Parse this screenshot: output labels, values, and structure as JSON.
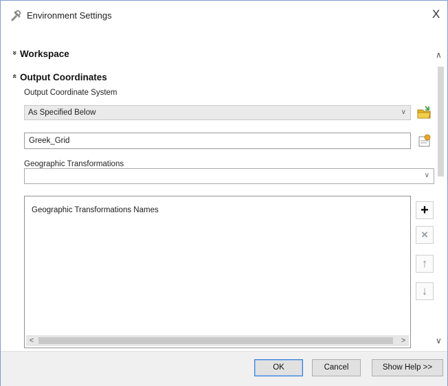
{
  "window": {
    "title": "Environment Settings",
    "close_glyph": "X"
  },
  "sections": {
    "workspace": {
      "label": "Workspace",
      "chevron": "»",
      "state": "collapsed"
    },
    "output_coordinates": {
      "label": "Output Coordinates",
      "chevron": "«",
      "state": "expanded"
    }
  },
  "output_coordinate_system": {
    "label": "Output Coordinate System",
    "selected": "As Specified Below",
    "value": "Greek_Grid"
  },
  "geographic_transformations": {
    "label": "Geographic Transformations",
    "selected": "",
    "list_header": "Geographic Transformations Names"
  },
  "tools": {
    "add": "+",
    "remove": "×",
    "move_up": "↑",
    "move_down": "↓"
  },
  "scroll": {
    "left": "<",
    "right": ">"
  },
  "footer": {
    "ok": "OK",
    "cancel": "Cancel",
    "show_help": "Show Help >>"
  },
  "colors": {
    "accent": "#3c7fd6",
    "border": "#7a9ccc",
    "folder_icon": "#e6b422"
  }
}
